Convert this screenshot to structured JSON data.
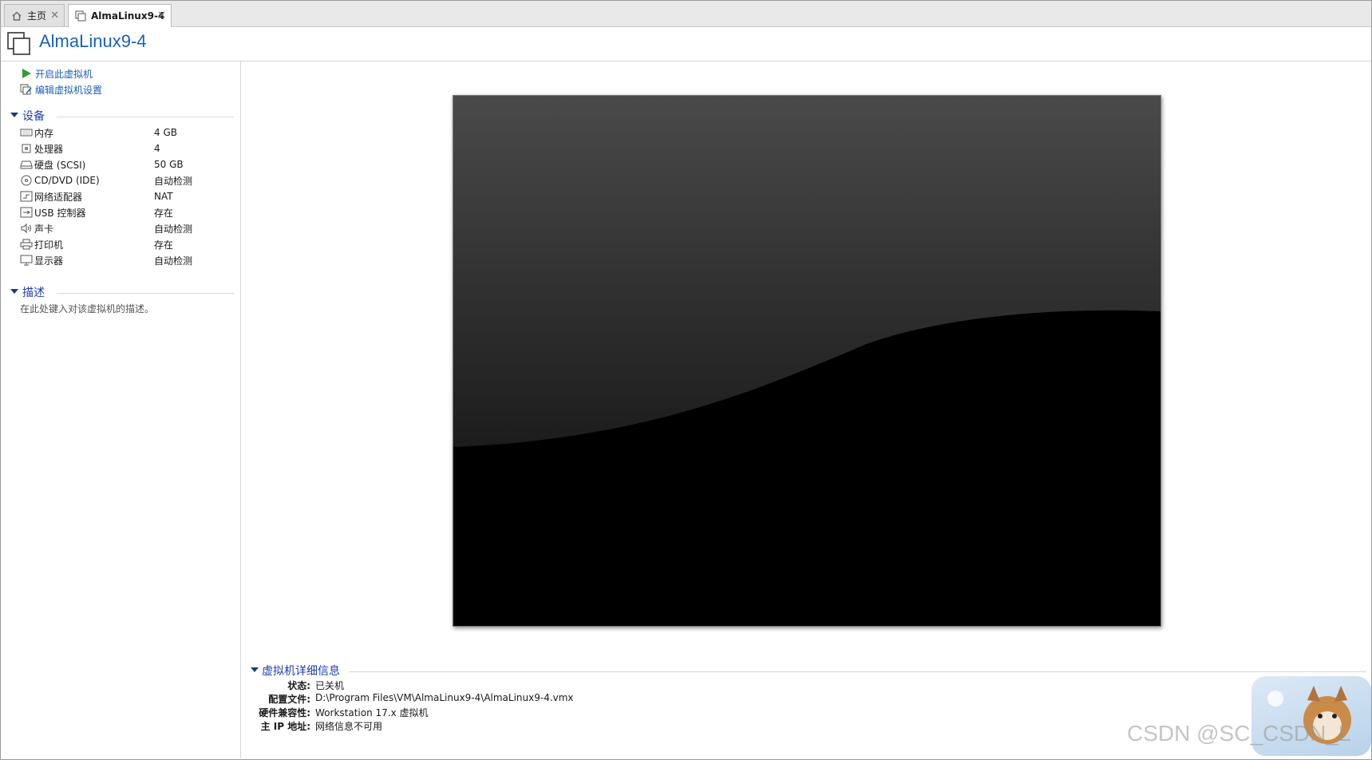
{
  "tabs": [
    {
      "label": "主页",
      "icon": "home-icon"
    },
    {
      "label": "AlmaLinux9-4",
      "icon": "vm-icon"
    }
  ],
  "tab_close_glyph": "✕",
  "vm": {
    "title": "AlmaLinux9-4"
  },
  "actions": {
    "power_on": "开启此虚拟机",
    "edit_settings": "编辑虚拟机设置"
  },
  "devices_section": {
    "label": "设备"
  },
  "devices": [
    {
      "name": "内存",
      "value": "4 GB",
      "icon": "memory-icon"
    },
    {
      "name": "处理器",
      "value": "4",
      "icon": "cpu-icon"
    },
    {
      "name": "硬盘 (SCSI)",
      "value": "50 GB",
      "icon": "harddisk-icon"
    },
    {
      "name": "CD/DVD (IDE)",
      "value": "自动检测",
      "icon": "cd-dvd-icon"
    },
    {
      "name": "网络适配器",
      "value": "NAT",
      "icon": "network-icon"
    },
    {
      "name": "USB 控制器",
      "value": "存在",
      "icon": "usb-icon"
    },
    {
      "name": "声卡",
      "value": "自动检测",
      "icon": "sound-icon"
    },
    {
      "name": "打印机",
      "value": "存在",
      "icon": "printer-icon"
    },
    {
      "name": "显示器",
      "value": "自动检测",
      "icon": "display-icon"
    }
  ],
  "description_section": {
    "label": "描述",
    "placeholder": "在此处键入对该虚拟机的描述。"
  },
  "details_section": {
    "label": "虚拟机详细信息"
  },
  "details": [
    {
      "key": "状态:",
      "value": "已关机"
    },
    {
      "key": "配置文件:",
      "value": "D:\\Program Files\\VM\\AlmaLinux9-4\\AlmaLinux9-4.vmx"
    },
    {
      "key": "硬件兼容性:",
      "value": "Workstation 17.x 虚拟机"
    },
    {
      "key": "主 IP 地址:",
      "value": "网络信息不可用"
    }
  ],
  "watermark": "CSDN @SC_CSDN_L",
  "colors": {
    "accent": "#1c5fb8",
    "section": "#1c3fa8",
    "play": "#2e9e2e"
  }
}
